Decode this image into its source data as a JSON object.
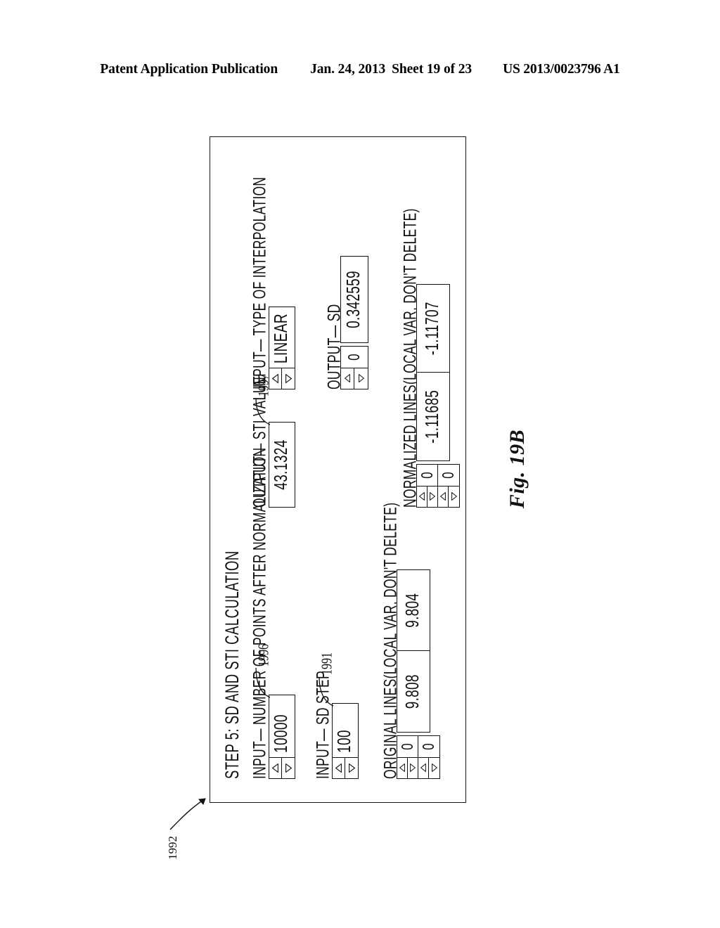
{
  "header": {
    "publication": "Patent Application Publication",
    "date": "Jan. 24, 2013",
    "sheet": "Sheet 19 of 23",
    "patent_number": "US 2013/0023796 A1"
  },
  "figure": {
    "caption": "Fig. 19B",
    "reference_numeral": "1992"
  },
  "panel": {
    "title": "STEP 5:  SD AND STI CALCULATION",
    "controls": [
      {
        "label": "INPUT—  NUMBER OF POINTS AFTER NORMALIZATION",
        "value": "10000",
        "ref": "1996",
        "type": "numeric-spinner"
      },
      {
        "label": "INPUT—  SD STEP",
        "value": "100",
        "ref": "1991",
        "type": "numeric-spinner"
      },
      {
        "label": "INPUT—  TYPE OF INTERPOLATION",
        "value": "LINEAR",
        "type": "enum-spinner"
      },
      {
        "label": "OUTPUT—  STI VALUE",
        "value": "43.1324",
        "ref": "1997",
        "type": "numeric-indicator"
      },
      {
        "label": "OUTPUT—  SD",
        "index": "0",
        "values": [
          "0.342559"
        ],
        "type": "array-1d"
      }
    ],
    "arrays": [
      {
        "label": "ORIGINAL LINES(LOCAL VAR, DON'T DELETE)",
        "index_row": "0",
        "index_col": "0",
        "values": [
          "9.808",
          "9.804"
        ],
        "type": "array-2d"
      },
      {
        "label": "NORMALIZED LINES(LOCAL VAR, DON'T DELETE)",
        "index_row": "0",
        "index_col": "0",
        "values": [
          "-1.11685",
          "-1.11707"
        ],
        "type": "array-2d"
      }
    ],
    "spinner_icons": {
      "increment": "triangle-up-icon",
      "decrement": "triangle-down-icon"
    }
  },
  "colors": {
    "ink": "#111111",
    "paper": "#ffffff"
  }
}
